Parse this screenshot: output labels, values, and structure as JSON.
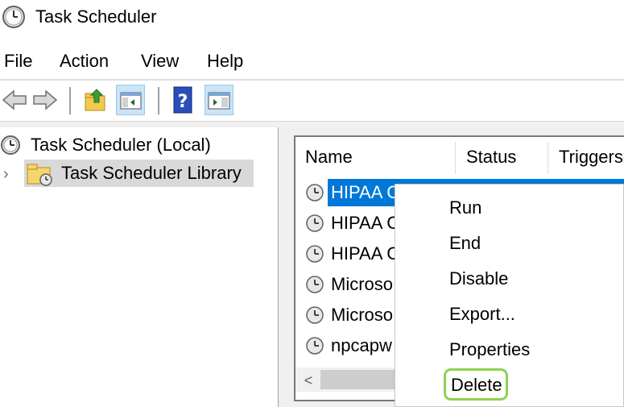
{
  "window": {
    "title": "Task Scheduler"
  },
  "menu": [
    {
      "label": "File"
    },
    {
      "label": "Action"
    },
    {
      "label": "View"
    },
    {
      "label": "Help"
    }
  ],
  "toolbar": {
    "buttons": [
      {
        "icon": "back-arrow-icon"
      },
      {
        "icon": "forward-arrow-icon"
      },
      {
        "icon": "up-folder-icon"
      },
      {
        "icon": "show-hide-console-tree-icon"
      },
      {
        "icon": "help-icon"
      },
      {
        "icon": "show-hide-action-pane-icon"
      }
    ]
  },
  "tree": {
    "root": {
      "label": "Task Scheduler (Local)",
      "icon": "clock-icon"
    },
    "library": {
      "label": "Task Scheduler Library",
      "icon": "clock-folder-icon"
    }
  },
  "task_list": {
    "columns": [
      "Name",
      "Status",
      "Triggers"
    ],
    "rows": [
      {
        "name": "HIPAA C",
        "selected": true
      },
      {
        "name": "HIPAA C"
      },
      {
        "name": "HIPAA C"
      },
      {
        "name": "Microso"
      },
      {
        "name": "Microso"
      },
      {
        "name": "npcapw"
      }
    ],
    "scroll_left_glyph": "<"
  },
  "context_menu": {
    "items": [
      "Run",
      "End",
      "Disable",
      "Export...",
      "Properties",
      "Delete"
    ],
    "highlighted": "Delete",
    "highlight_color": "#8fd14f"
  },
  "colors": {
    "selection": "#0078d7",
    "pressed_button": "#cce4f7"
  }
}
